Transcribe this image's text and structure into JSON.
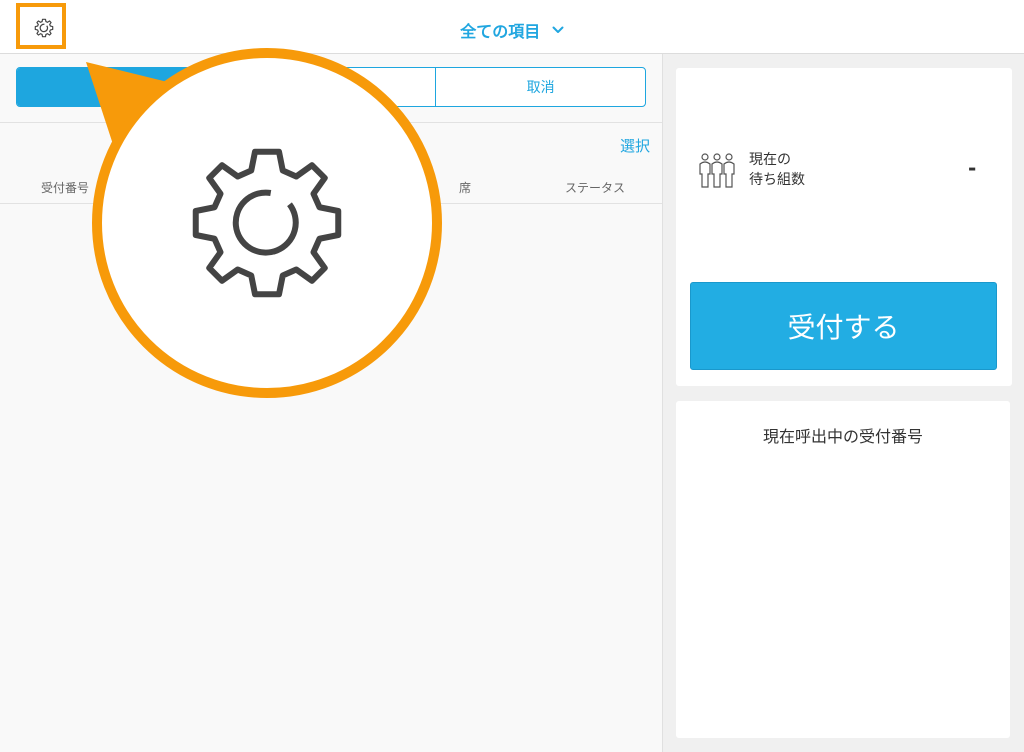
{
  "header": {
    "title": "全ての項目",
    "settings_icon": "gear-icon",
    "dropdown_icon": "chevron-down-icon"
  },
  "segment": {
    "options": [
      "",
      "",
      "取消"
    ],
    "selected_index": 0
  },
  "list": {
    "select_label": "選択",
    "columns": [
      "受付番号",
      "席",
      "ステータス"
    ]
  },
  "waiting": {
    "label_line1": "現在の",
    "label_line2": "待ち組数",
    "value": "-",
    "icon": "people-group-icon"
  },
  "accept_button": "受付する",
  "calling": {
    "title": "現在呼出中の受付番号"
  },
  "colors": {
    "accent": "#20a6e0",
    "highlight": "#f79a0a"
  }
}
